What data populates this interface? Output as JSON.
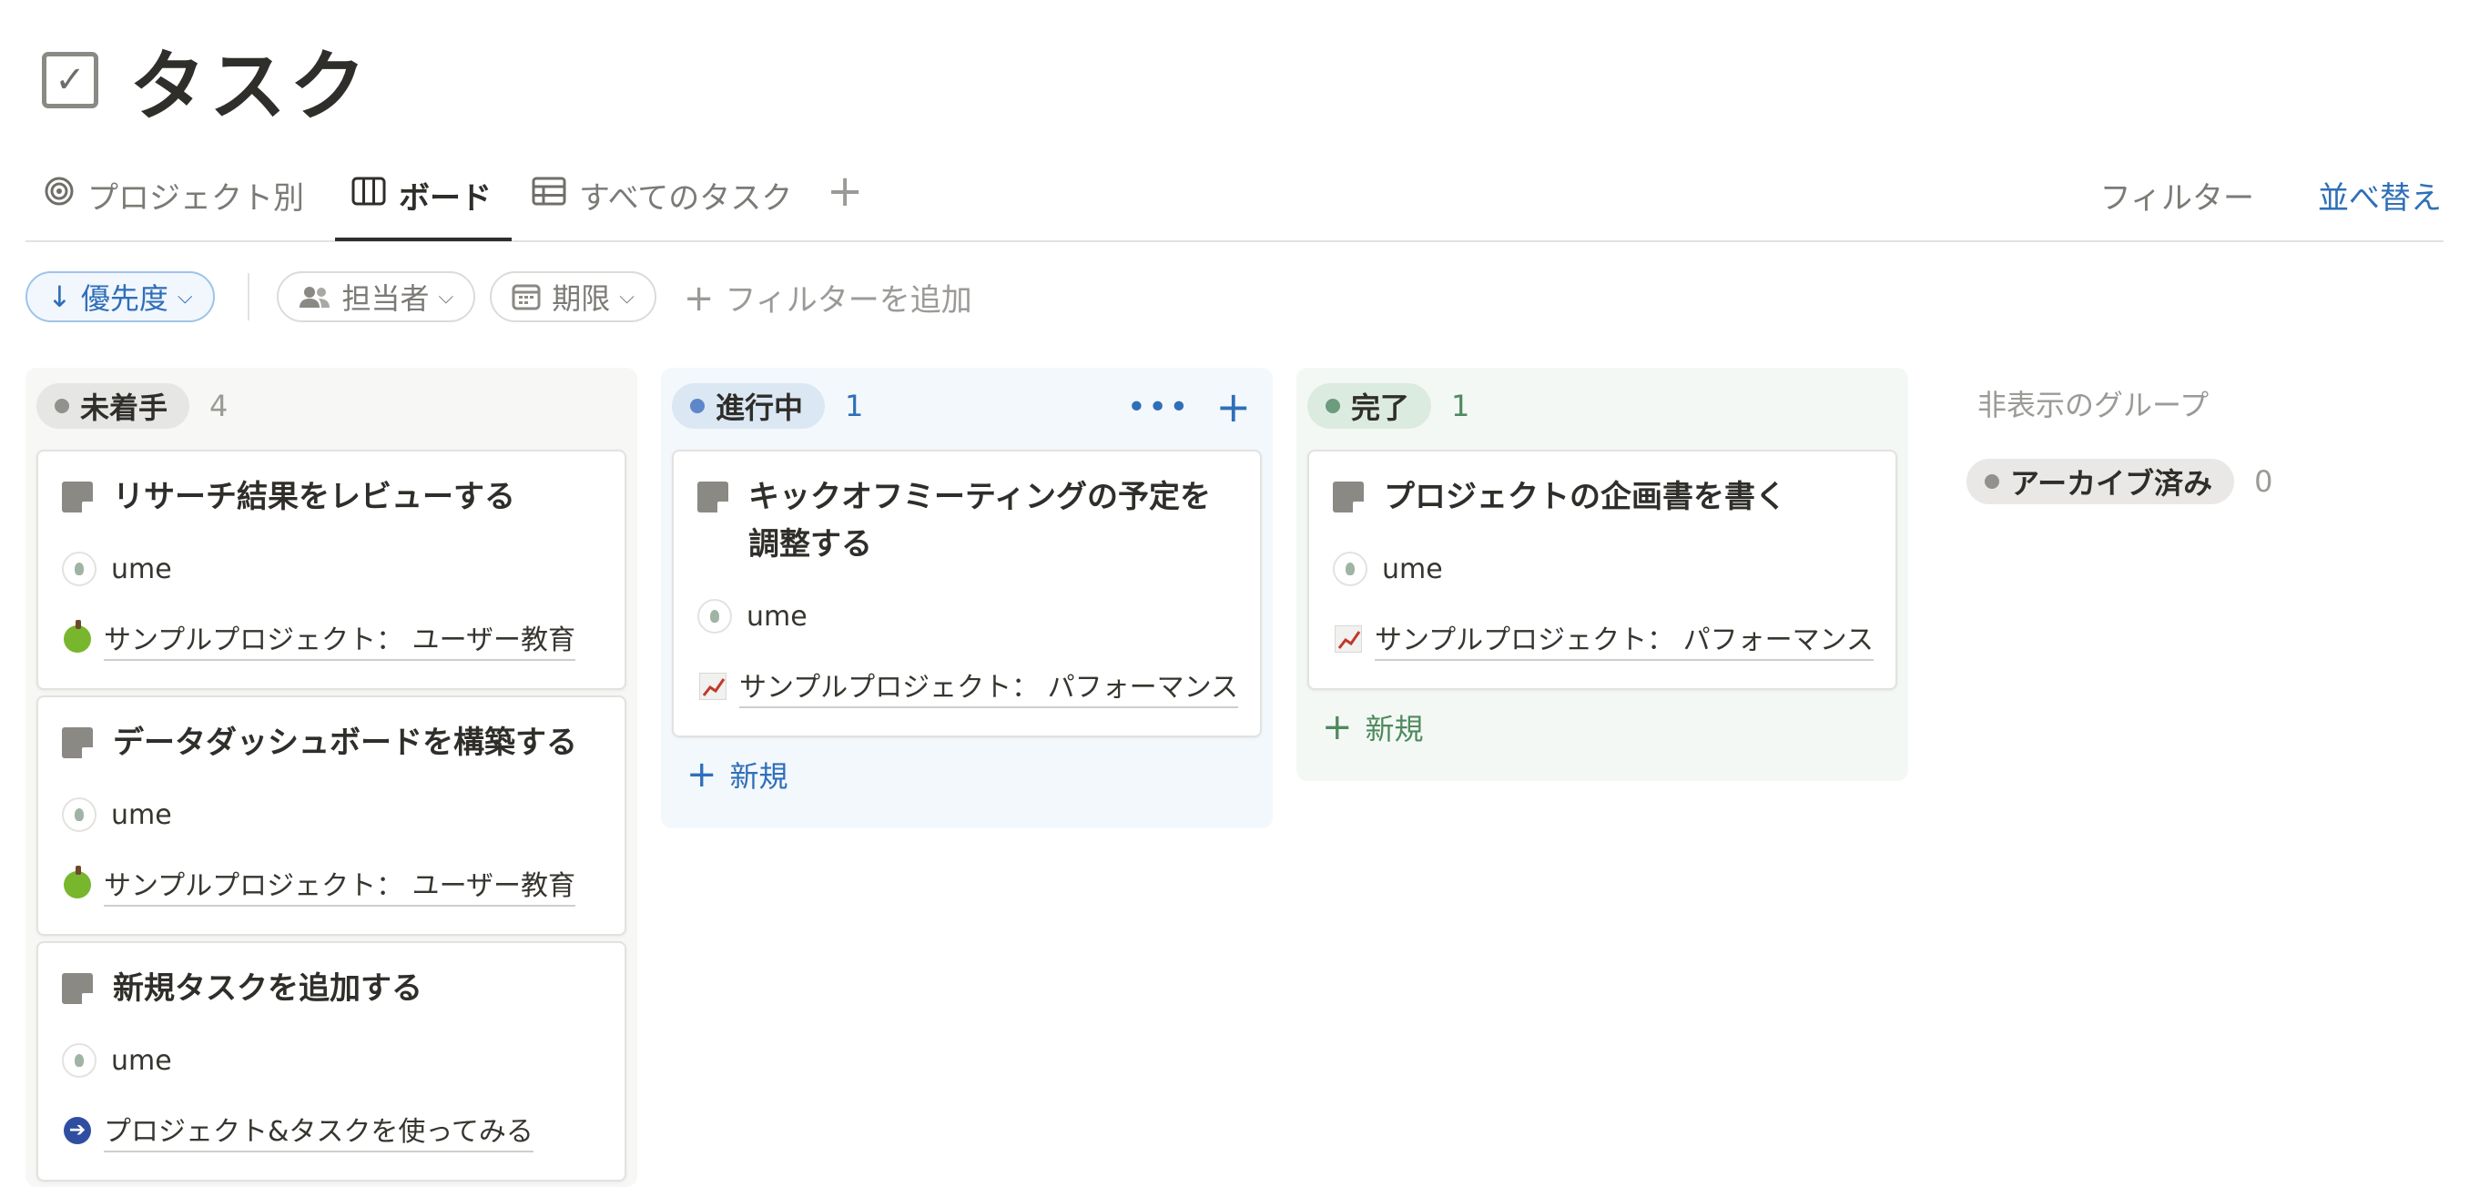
{
  "page": {
    "title": "タスク",
    "title_icon": "checkbox-icon"
  },
  "tabs": [
    {
      "label": "プロジェクト別",
      "icon": "target-icon"
    },
    {
      "label": "ボード",
      "icon": "board-icon",
      "active": true
    },
    {
      "label": "すべてのタスク",
      "icon": "table-icon"
    }
  ],
  "toolbar": {
    "filter_label": "フィルター",
    "sort_label": "並べ替え"
  },
  "filters": [
    {
      "label": "優先度",
      "prefix": "↓",
      "active": true
    },
    {
      "label": "担当者",
      "icon": "people-icon"
    },
    {
      "label": "期限",
      "icon": "calendar-icon"
    }
  ],
  "add_filter_label": "フィルターを追加",
  "columns": [
    {
      "status": "未着手",
      "count": "4",
      "dot_color": "#91918e",
      "pill_bg": "#e6e6e4",
      "col_bg": "#f7f7f5",
      "cards": [
        {
          "title": "リサーチ結果をレビューする",
          "assignee": "ume",
          "project_icon": "apple-icon",
          "project": "サンプルプロジェクト： ユーザー教育"
        },
        {
          "title": "データダッシュボードを構築する",
          "assignee": "ume",
          "project_icon": "apple-icon",
          "project": "サンプルプロジェクト： ユーザー教育"
        },
        {
          "title": "新規タスクを追加する",
          "assignee": "ume",
          "project_icon": "arrow-right-icon",
          "project": "プロジェクト&タスクを使ってみる"
        }
      ]
    },
    {
      "status": "進行中",
      "count": "1",
      "dot_color": "#5e87c9",
      "pill_bg": "#dce7f4",
      "col_bg": "#f3f8fc",
      "cards": [
        {
          "title_line1": "キックオフミーティングの予定を",
          "title_line2": "調整する",
          "assignee": "ume",
          "project_icon": "chart-icon",
          "project": "サンプルプロジェクト： パフォーマンス"
        }
      ],
      "new_label": "新規"
    },
    {
      "status": "完了",
      "count": "1",
      "dot_color": "#6c9b7d",
      "pill_bg": "#dcebdf",
      "col_bg": "#f4f8f4",
      "cards": [
        {
          "title": "プロジェクトの企画書を書く",
          "assignee": "ume",
          "project_icon": "chart-icon",
          "project": "サンプルプロジェクト： パフォーマンス"
        }
      ],
      "new_label": "新規"
    }
  ],
  "hidden_groups": {
    "label": "非表示のグループ",
    "items": [
      {
        "status": "アーカイブ済み",
        "count": "0"
      }
    ]
  },
  "colors": {
    "accent_blue": "#2f6fb9",
    "text_primary": "#37352f",
    "text_secondary": "#9b9a97"
  }
}
